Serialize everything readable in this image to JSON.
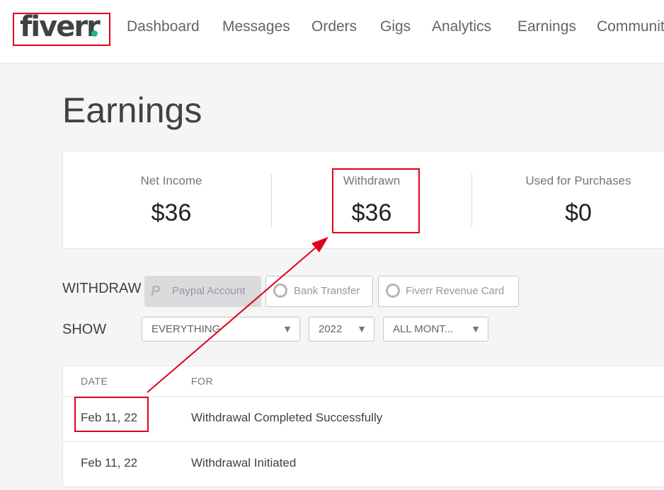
{
  "header": {
    "logo": "fiverr",
    "nav": [
      "Dashboard",
      "Messages",
      "Orders",
      "Gigs",
      "Analytics",
      "Earnings",
      "Communit"
    ]
  },
  "page": {
    "title": "Earnings"
  },
  "stats": {
    "net_income": {
      "label": "Net Income",
      "value": "$36"
    },
    "withdrawn": {
      "label": "Withdrawn",
      "value": "$36"
    },
    "used_for_purchases": {
      "label": "Used for Purchases",
      "value": "$0"
    }
  },
  "withdraw": {
    "label": "WITHDRAW",
    "methods": [
      "Paypal Account",
      "Bank Transfer",
      "Fiverr Revenue Card"
    ]
  },
  "show": {
    "label": "SHOW",
    "type_filter": "EVERYTHING",
    "year_filter": "2022",
    "month_filter": "ALL MONT..."
  },
  "table": {
    "headers": [
      "DATE",
      "FOR"
    ],
    "rows": [
      {
        "date": "Feb 11, 22",
        "for": "Withdrawal Completed Successfully"
      },
      {
        "date": "Feb 11, 22",
        "for": "Withdrawal Initiated"
      }
    ]
  },
  "colors": {
    "brand_green": "#1dbf73",
    "annotation_red": "#e0001b"
  }
}
